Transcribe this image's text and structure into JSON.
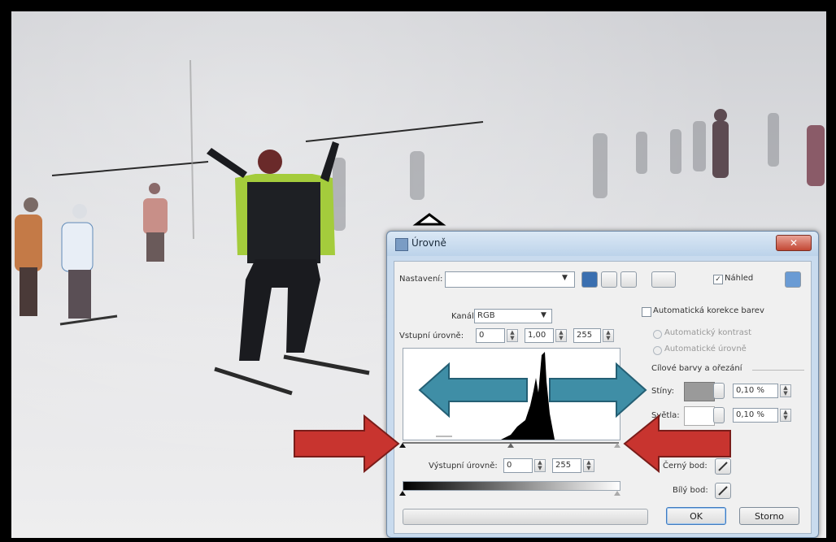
{
  "dialog": {
    "title": "Úrovně",
    "close_label": "✕",
    "preset": {
      "label": "Nastavení:",
      "value": ""
    },
    "preview_label": "Náhled",
    "channel": {
      "label": "Kanál:",
      "value": "RGB"
    },
    "input_levels": {
      "label": "Vstupní úrovně:",
      "black": "0",
      "gamma": "1,00",
      "white": "255"
    },
    "output_levels": {
      "label": "Výstupní úrovně:",
      "black": "0",
      "white": "255"
    },
    "auto_correction_label": "Automatická korekce barev",
    "auto_contrast_label": "Automatický kontrast",
    "auto_levels_label": "Automatické úrovně",
    "target_section_label": "Cílové barvy a ořezání",
    "shadows": {
      "label": "Stíny:",
      "clip": "0,10 %"
    },
    "highlights": {
      "label": "Světla:",
      "clip": "0,10 %"
    },
    "black_point_label": "Černý bod:",
    "white_point_label": "Bílý bod:",
    "ok_label": "OK",
    "cancel_label": "Storno"
  },
  "colors": {
    "highlight_arrow": "#3f8ea6",
    "red_arrow": "#c8342f"
  },
  "icons": {
    "save": "save-icon",
    "load": "load-icon",
    "reset": "reset-icon",
    "menu": "menu-icon",
    "eyedropper": "eyedropper-icon"
  }
}
